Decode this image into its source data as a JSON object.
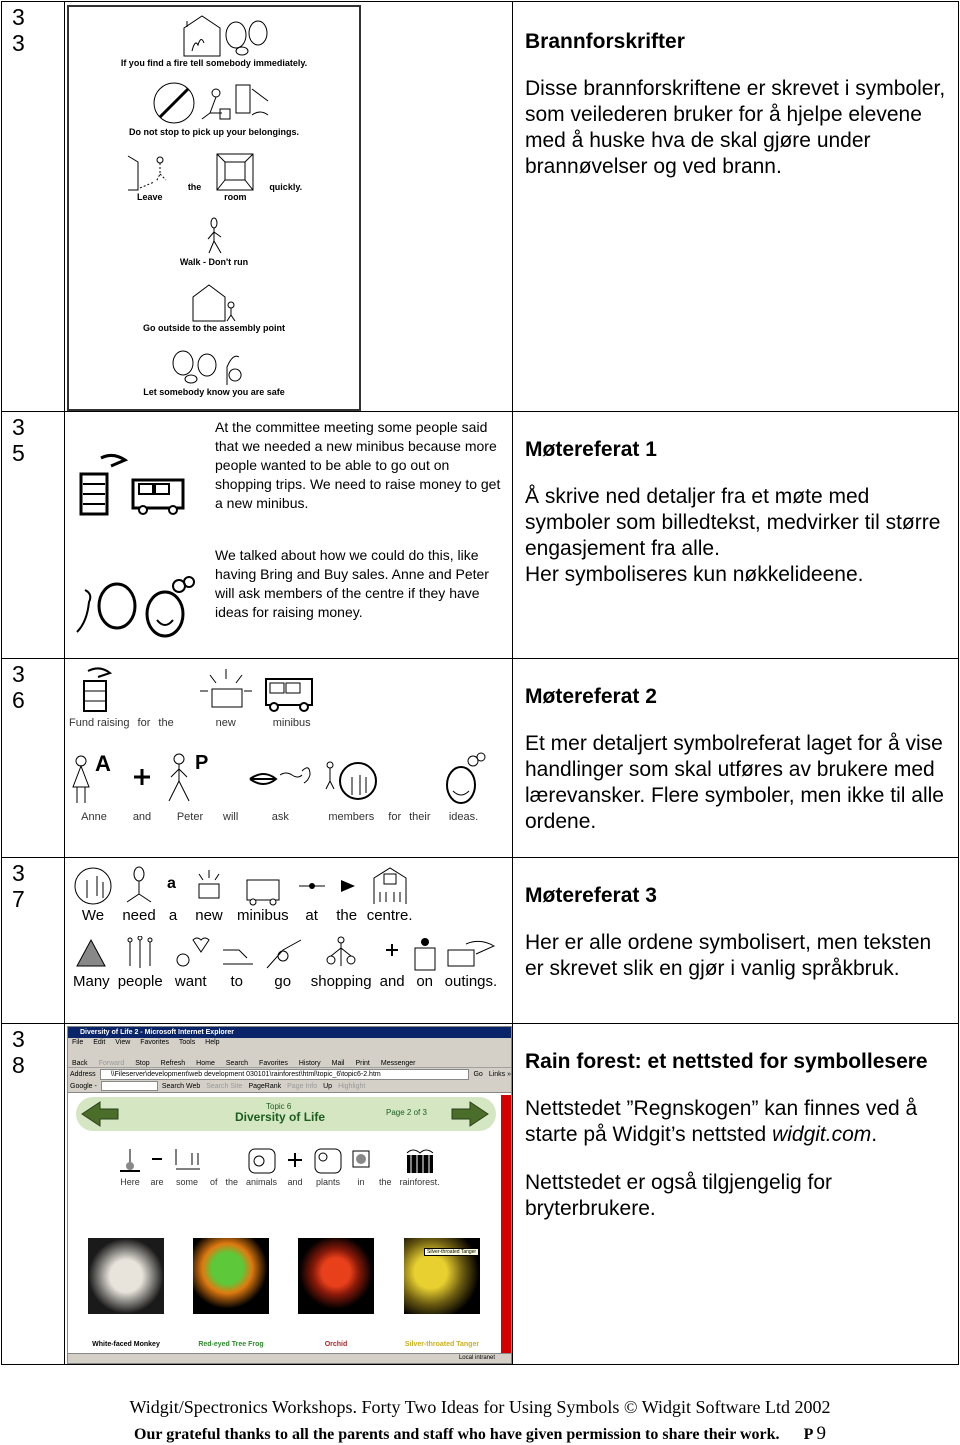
{
  "rows": [
    {
      "number": [
        "3",
        "3"
      ],
      "title": "Brannforskrifter",
      "paragraphs": [
        "Disse brannforskriftene er skrevet i symboler, som veilederen bruker for å hjelpe elevene med å huske hva de skal gjøre under brannøvelser og ved brann."
      ],
      "image": {
        "captions": [
          "If you find a fire tell somebody immediately.",
          "Do not stop to pick up your belongings.",
          "Walk - Don't run",
          "Go outside to the assembly point",
          "Let somebody know you are safe"
        ],
        "leave_words": [
          "Leave",
          "the",
          "room",
          "quickly."
        ]
      }
    },
    {
      "number": [
        "3",
        "5"
      ],
      "title": "Møtereferat 1",
      "paragraphs": [
        "Å skrive ned detaljer fra et møte med symboler som billedtekst, medvirker til større engasjement fra alle.",
        "Her symboliseres kun nøkkelideene."
      ],
      "image": {
        "text1": "At the committee meeting some people said that we needed a new minibus because more people wanted to be able to go out on shopping trips.  We need to raise money to get a new minibus.",
        "text2": "We talked about how we could do this, like having Bring and Buy sales. Anne and Peter will ask members of the centre if they have ideas for raising money."
      }
    },
    {
      "number": [
        "3",
        "6"
      ],
      "title": "Møtereferat 2",
      "paragraphs": [
        "Et mer detaljert symbolreferat laget for å vise handlinger som skal utføres av brukere med lærevansker. Flere symboler, men ikke til alle ordene."
      ],
      "image": {
        "line1": [
          "Fund raising",
          "for",
          "the",
          "new",
          "minibus"
        ],
        "line2": [
          "Anne",
          "and",
          "Peter",
          "will",
          "ask",
          "members",
          "for",
          "their",
          "ideas."
        ]
      }
    },
    {
      "number": [
        "3",
        "7"
      ],
      "title": "Møtereferat 3",
      "paragraphs": [
        "Her er alle ordene symbolisert, men teksten er skrevet slik en gjør i vanlig språkbruk."
      ],
      "image": {
        "line1": [
          "We",
          "need",
          "a",
          "new",
          "minibus",
          "at",
          "the",
          "centre."
        ],
        "line2": [
          "Many",
          "people",
          "want",
          "to",
          "go",
          "shopping",
          "and",
          "on",
          "outings."
        ]
      }
    },
    {
      "number": [
        "3",
        "8"
      ],
      "title": "Rain forest: et nettsted for symbollesere",
      "paragraphs_html": {
        "p1_a": "Nettstedet ”Regnskogen” kan finnes ved å starte på Widgit’s nettsted ",
        "p1_italic": "widgit.com",
        "p1_b": ".",
        "p2": "Nettstedet er også tilgjengelig for bryterbrukere."
      },
      "browser": {
        "window_title": "Diversity of Life 2 - Microsoft Internet Explorer",
        "menu": [
          "File",
          "Edit",
          "View",
          "Favorites",
          "Tools",
          "Help"
        ],
        "toolbar": [
          "Back",
          "Forward",
          "Stop",
          "Refresh",
          "Home",
          "Search",
          "Favorites",
          "History",
          "Mail",
          "Print",
          "Messenger"
        ],
        "address_label": "Address",
        "address": "\\\\Fileserver\\development\\web development 030101\\rainforest\\html\\topic_6\\topic6-2.htm",
        "go": "Go",
        "links": "Links »",
        "google_label": "Google -",
        "google_buttons": [
          "Search Web",
          "Search Site",
          "PageRank",
          "Page Info",
          "Up",
          "Highlight"
        ],
        "topic": "Topic 6",
        "heading": "Diversity of Life",
        "page": "Page 2 of 3",
        "sentence": [
          "Here",
          "are",
          "some",
          "of",
          "the",
          "animals",
          "and",
          "plants",
          "in",
          "the",
          "rainforest."
        ],
        "photos": [
          {
            "label": "White-faced Monkey",
            "color": "#222222"
          },
          {
            "label": "Red-eyed Tree Frog",
            "color": "#2e8b2e"
          },
          {
            "label": "Orchid",
            "color": "#a52a2a"
          },
          {
            "label": "Silver-throated Tanger",
            "color": "#c8b020"
          }
        ],
        "tooltip": "Silver-throated Tanger",
        "status": "Local intranet"
      }
    }
  ],
  "footer": {
    "line1": "Widgit/Spectronics Workshops. Forty Two Ideas for Using Symbols © Widgit Software Ltd 2002",
    "line2": "Our grateful thanks to all the parents and staff who have given permission to share their work.",
    "page_prefix": "P",
    "page_number": "9"
  }
}
